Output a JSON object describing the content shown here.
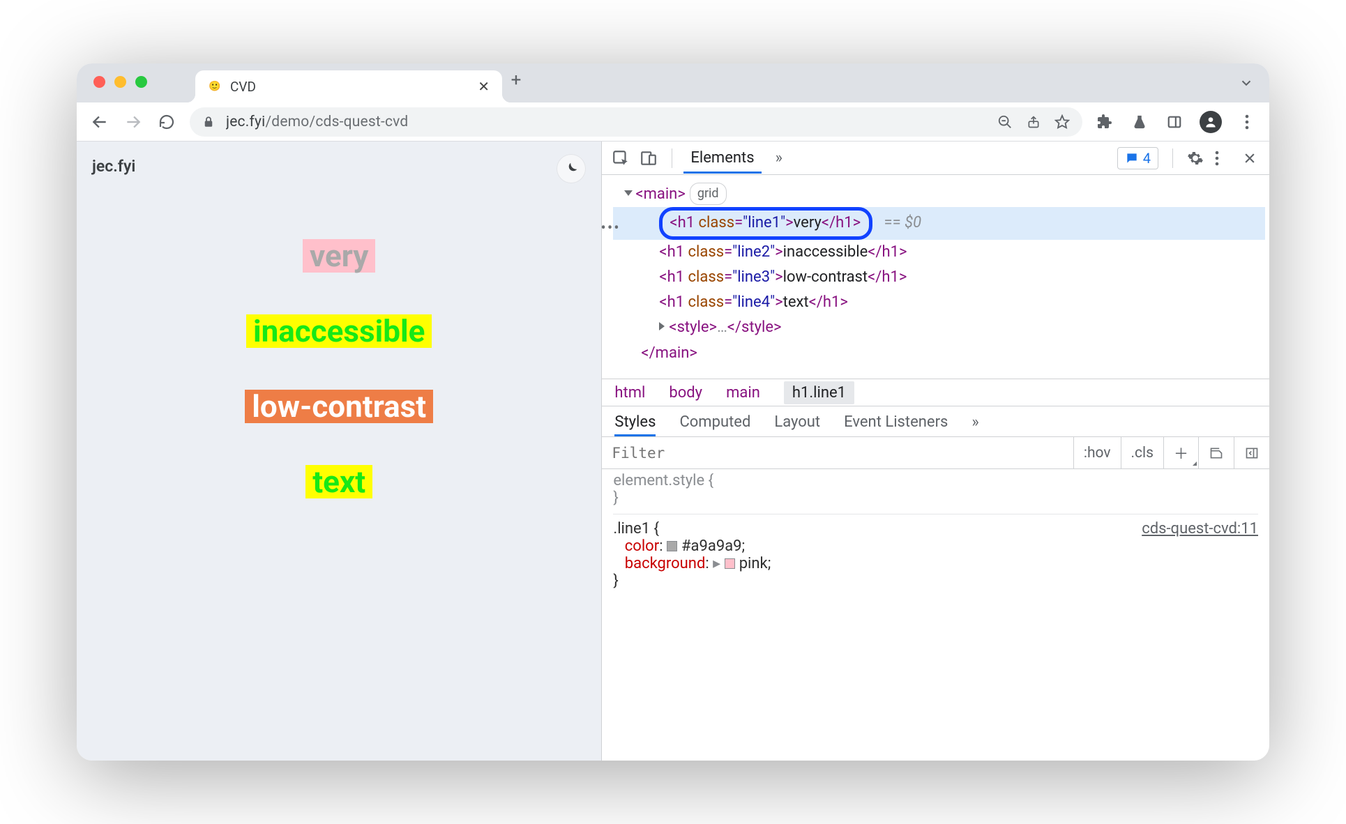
{
  "window": {
    "tab_title": "CVD",
    "favicon": "🙂"
  },
  "toolbar": {
    "url_host": "jec.fyi",
    "url_path": "/demo/cds-quest-cvd"
  },
  "page": {
    "site_label": "jec.fyi",
    "words": {
      "w1": "very",
      "w2": "inaccessible",
      "w3": "low-contrast",
      "w4": "text"
    }
  },
  "devtools": {
    "tabs": {
      "elements": "Elements",
      "more": "»"
    },
    "issues_count": "4",
    "tree": {
      "main_open": "<main>",
      "main_close": "</main>",
      "grid_pill": "grid",
      "line1_open": "<h1 class=\"line1\">",
      "line1_txt": "very",
      "line1_close": "</h1>",
      "sel_suffix_eq": "== ",
      "sel_suffix_var": "$0",
      "line2_open": "<h1 class=\"line2\">",
      "line2_txt": "inaccessible",
      "line2_close": "</h1>",
      "line3_open": "<h1 class=\"line3\">",
      "line3_txt": "low-contrast",
      "line3_close": "</h1>",
      "line4_open": "<h1 class=\"line4\">",
      "line4_txt": "text",
      "line4_close": "</h1>",
      "style_collapsed": "<style>…</style>"
    },
    "crumbs": [
      "html",
      "body",
      "main",
      "h1.line1"
    ],
    "subtabs": {
      "styles": "Styles",
      "computed": "Computed",
      "layout": "Layout",
      "listeners": "Event Listeners",
      "more": "»"
    },
    "filter": {
      "placeholder": "Filter",
      "hov": ":hov",
      "cls": ".cls"
    },
    "styles": {
      "element_style": "element.style {",
      "brace_close": "}",
      "rule_selector": ".line1 {",
      "rule_source": "cds-quest-cvd:11",
      "p_color_name": "color",
      "p_color_val": "#a9a9a9",
      "p_bg_name": "background",
      "p_bg_val": "pink"
    }
  }
}
